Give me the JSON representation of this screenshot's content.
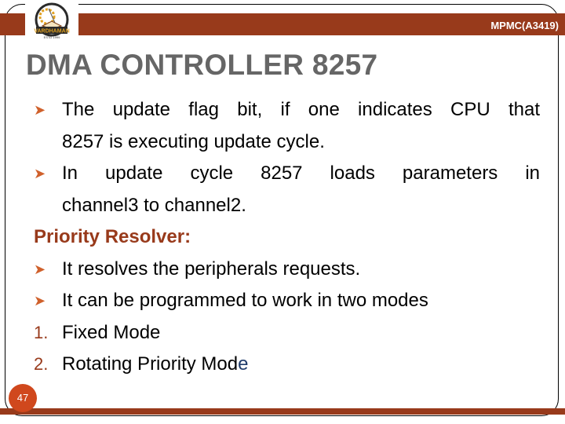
{
  "header": {
    "course_code": "MPMC(A3419)",
    "logo_text": "VARDHAMAN",
    "logo_subtext": "ESTD 1999"
  },
  "slide": {
    "title": "DMA CONTROLLER 8257",
    "bullets_top": [
      {
        "line1": "The update flag bit, if one indicates CPU that",
        "line2": "8257 is executing update cycle."
      },
      {
        "line1": "In update cycle 8257 loads parameters in",
        "line2": "channel3 to channel2."
      }
    ],
    "section_heading": "Priority Resolver:",
    "bullets_bottom": [
      "It resolves the peripherals requests.",
      "It can be programmed to work in two modes"
    ],
    "numbered": [
      {
        "num": "1.",
        "text": "Fixed Mode"
      },
      {
        "num": "2.",
        "text_main": "Rotating Priority Mod",
        "text_last": "e"
      }
    ],
    "page_number": "47"
  },
  "colors": {
    "accent_bar": "#983a1b",
    "bullet_arrow": "#d0612c",
    "page_badge": "#d0481d",
    "title_gray": "#666666"
  }
}
